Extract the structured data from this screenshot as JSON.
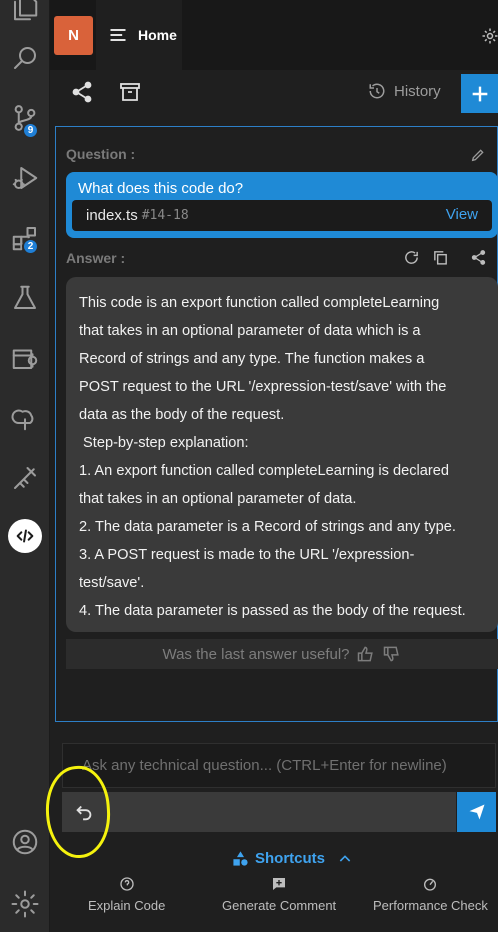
{
  "activity_bar": {
    "source_control_badge": "9",
    "extensions_badge": "2"
  },
  "tab": {
    "avatar_initial": "N",
    "home_label": "Home"
  },
  "toolbar": {
    "history_label": "History"
  },
  "question": {
    "label": "Question :",
    "text": "What does this code do?",
    "file_name": "index.ts",
    "file_lines": "#14-18",
    "view_label": "View"
  },
  "answer": {
    "label": "Answer :",
    "lines": [
      "This code is an export function called completeLearning",
      "that takes in an optional parameter of data which is a",
      "Record of strings and any type. The function makes a",
      "POST request to the URL '/expression-test/save' with the",
      "data as the body of the request.",
      " Step-by-step explanation:",
      "1. An export function called completeLearning is declared",
      "that takes in an optional parameter of data.",
      "2. The data parameter is a Record of strings and any type.",
      "3. A POST request is made to the URL '/expression-",
      "test/save'.",
      "4. The data parameter is passed as the body of the request."
    ],
    "feedback_prompt": "Was the last answer useful?"
  },
  "input": {
    "placeholder": "Ask any technical question... (CTRL+Enter for newline)"
  },
  "shortcuts": {
    "title": "Shortcuts",
    "items": [
      {
        "label": "Explain Code"
      },
      {
        "label": "Generate Comment"
      },
      {
        "label": "Performance Check"
      }
    ]
  },
  "colors": {
    "accent": "#1f8ad6",
    "annotation": "#f5f20e",
    "avatar": "#d9623a"
  }
}
